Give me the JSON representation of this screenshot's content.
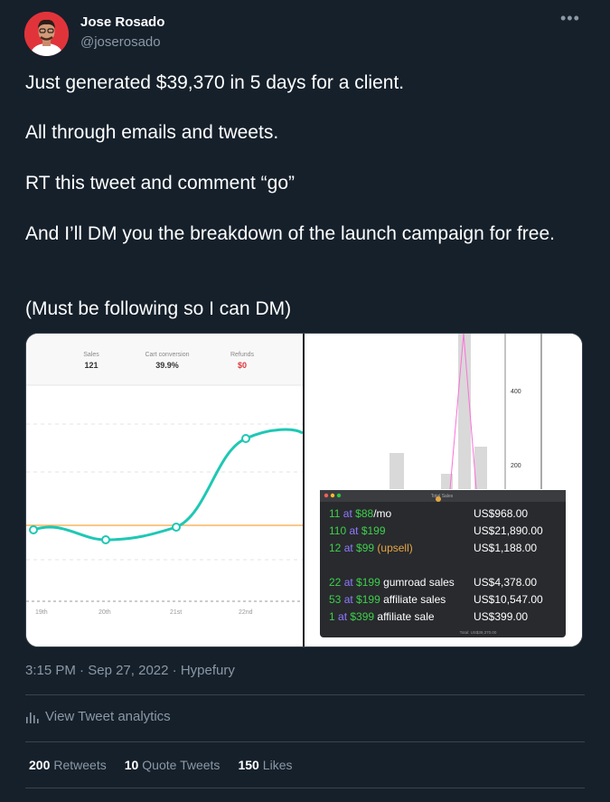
{
  "author": {
    "name": "Jose Rosado",
    "handle": "@joserosado"
  },
  "tweet": {
    "paragraphs": [
      "Just generated $39,370 in 5 days for a client.",
      "All through emails and tweets.",
      "RT this tweet and comment “go”",
      "And I’ll DM you the breakdown of the launch campaign for free.",
      "(Must be following so I can DM)"
    ]
  },
  "media": {
    "left": {
      "stats": [
        {
          "label": "Sales",
          "value": "121"
        },
        {
          "label": "Cart conversion",
          "value": "39.9%"
        },
        {
          "label": "Refunds",
          "value": "$0"
        }
      ],
      "x_ticks": [
        "19th",
        "20th",
        "21st",
        "22nd"
      ]
    },
    "top_right": {
      "y_ticks": [
        "400",
        "200"
      ]
    },
    "bottom_right": {
      "window_title": "Total Sales",
      "rows": [
        {
          "qty": "11",
          "price": "$88",
          "suffix": "/mo",
          "amount": "US$968.00"
        },
        {
          "qty": "110",
          "price": "$199",
          "suffix": "",
          "amount": "US$21,890.00"
        },
        {
          "qty": "12",
          "price": "$99",
          "suffix": " (upsell)",
          "amount": "US$1,188.00"
        },
        {
          "qty": "22",
          "price": "$199",
          "suffix": " gumroad sales",
          "amount": "US$4,378.00"
        },
        {
          "qty": "53",
          "price": "$199",
          "suffix": " affiliate sales",
          "amount": "US$10,547.00"
        },
        {
          "qty": "1",
          "price": "$399",
          "suffix": " affiliate sale",
          "amount": "US$399.00"
        }
      ],
      "total": "Total: US$39,370.00"
    }
  },
  "meta": {
    "time": "3:15 PM",
    "date": "Sep 27, 2022",
    "source": "Hypefury"
  },
  "analytics_label": "View Tweet analytics",
  "stats": {
    "retweets": "200",
    "retweets_label": "Retweets",
    "quotes": "10",
    "quotes_label": "Quote Tweets",
    "likes": "150",
    "likes_label": "Likes"
  },
  "colors": {
    "background": "#15202b",
    "text": "#ffffff",
    "muted": "#8b98a5",
    "chart_line": "#1ec8b4",
    "baseline": "#f5a742",
    "price_green": "#3ecf4a",
    "price_purple": "#8f7bff",
    "upsell_orange": "#e5a641"
  }
}
